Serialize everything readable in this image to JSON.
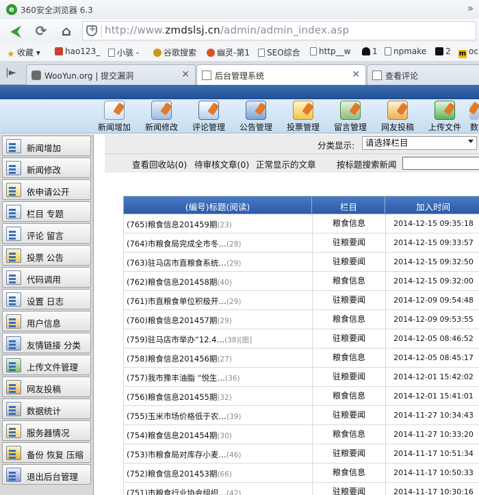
{
  "browser": {
    "title": "360安全浏览器 6.3",
    "url_prefix": "http://www.",
    "url_domain": "zmdslsj.cn",
    "url_path": "/admin/admin_index.asp"
  },
  "bookmarks": [
    {
      "label": "收藏",
      "icon": "star-icon"
    },
    {
      "label": "hao123_",
      "icon": "hao123-icon"
    },
    {
      "label": "小骇 -",
      "icon": "page-icon"
    },
    {
      "label": "谷歌搜索",
      "icon": "google-icon"
    },
    {
      "label": "幽灵-第1",
      "icon": "ghost-icon"
    },
    {
      "label": "SEO综合",
      "icon": "page-icon"
    },
    {
      "label": "http__w",
      "icon": "page-icon"
    },
    {
      "label": "1",
      "icon": "person-icon"
    },
    {
      "label": "npmake",
      "icon": "page-icon"
    },
    {
      "label": "2",
      "icon": "ghost-black-icon"
    },
    {
      "label": "oc",
      "icon": "m-icon"
    }
  ],
  "tabs": [
    {
      "label": "WooYun.org | 提交漏洞",
      "active": false
    },
    {
      "label": "后台管理系统",
      "active": true
    },
    {
      "label": "查看评论",
      "active": false
    }
  ],
  "topmenu": [
    {
      "label": "新闻增加",
      "icon": "news-add-icon"
    },
    {
      "label": "新闻修改",
      "icon": "news-edit-icon"
    },
    {
      "label": "评论管理",
      "icon": "comment-icon"
    },
    {
      "label": "公告管理",
      "icon": "notice-icon"
    },
    {
      "label": "投票管理",
      "icon": "vote-icon"
    },
    {
      "label": "留言管理",
      "icon": "message-icon"
    },
    {
      "label": "网友投稿",
      "icon": "submission-icon"
    },
    {
      "label": "上传文件",
      "icon": "upload-icon"
    },
    {
      "label": "数",
      "icon": "stats-icon"
    }
  ],
  "sidebar": [
    {
      "label": "新闻增加"
    },
    {
      "label": "新闻修改"
    },
    {
      "label": "依申请公开"
    },
    {
      "label": "栏目  专题"
    },
    {
      "label": "评论  留言"
    },
    {
      "label": "投票  公告"
    },
    {
      "label": "代码调用"
    },
    {
      "label": "设置  日志"
    },
    {
      "label": "用户信息"
    },
    {
      "label": "友情链接  分类"
    },
    {
      "label": "上传文件管理"
    },
    {
      "label": "网友投稿"
    },
    {
      "label": "数据统计"
    },
    {
      "label": "服务器情况"
    },
    {
      "label": "备份  恢复  压缩"
    },
    {
      "label": "退出后台管理"
    }
  ],
  "filter": {
    "category_label": "分类显示:",
    "category_value": "请选择栏目",
    "recycle": "查看回收站(0)",
    "pending": "待审核文章(0)",
    "normal": "正常显示的文章",
    "search_label": "按标题搜索新闻"
  },
  "table": {
    "headers": [
      "(编号)标题(阅读)",
      "栏目",
      "加入时间"
    ],
    "rows": [
      {
        "title": "(765)粮食信息201459期",
        "reads": "(23)",
        "column": "粮食信息",
        "time": "2014-12-15 09:35:18"
      },
      {
        "title": "(764)市粮食局完成全市冬…",
        "reads": "(28)",
        "column": "驻粮要闻",
        "time": "2014-12-15 09:33:57"
      },
      {
        "title": "(763)驻马店市直粮食系统…",
        "reads": "(29)",
        "column": "驻粮要闻",
        "time": "2014-12-15 09:32:50"
      },
      {
        "title": "(762)粮食信息201458期",
        "reads": "(40)",
        "column": "粮食信息",
        "time": "2014-12-15 09:32:00"
      },
      {
        "title": "(761)市直粮食单位积极开…",
        "reads": "(29)",
        "column": "驻粮要闻",
        "time": "2014-12-09 09:54:48"
      },
      {
        "title": "(760)粮食信息201457期",
        "reads": "(29)",
        "column": "粮食信息",
        "time": "2014-12-09 09:53:55"
      },
      {
        "title": "(759)驻马店市举办“12.4…",
        "reads": "(38)[图]",
        "column": "驻粮要闻",
        "time": "2014-12-05 08:46:52"
      },
      {
        "title": "(758)粮食信息201456期",
        "reads": "(27)",
        "column": "粮食信息",
        "time": "2014-12-05 08:45:17"
      },
      {
        "title": "(757)我市豫丰油脂 “悦生…",
        "reads": "(36)",
        "column": "驻粮要闻",
        "time": "2014-12-01 15:42:02"
      },
      {
        "title": "(756)粮食信息201455期",
        "reads": "(32)",
        "column": "粮食信息",
        "time": "2014-12-01 15:41:01"
      },
      {
        "title": "(755)玉米市场价格低于农…",
        "reads": "(39)",
        "column": "驻粮要闻",
        "time": "2014-11-27 10:34:43"
      },
      {
        "title": "(754)粮食信息201454期",
        "reads": "(30)",
        "column": "粮食信息",
        "time": "2014-11-27 10:33:20"
      },
      {
        "title": "(753)市粮食局对库存小麦…",
        "reads": "(46)",
        "column": "驻粮要闻",
        "time": "2014-11-17 10:51:34"
      },
      {
        "title": "(752)粮食信息201453期",
        "reads": "(66)",
        "column": "粮食信息",
        "time": "2014-11-17 10:50:33"
      },
      {
        "title": "(751)市粮食行业协会组织…",
        "reads": "(42)",
        "column": "驻粮要闻",
        "time": "2014-11-17 10:30:16"
      }
    ]
  }
}
